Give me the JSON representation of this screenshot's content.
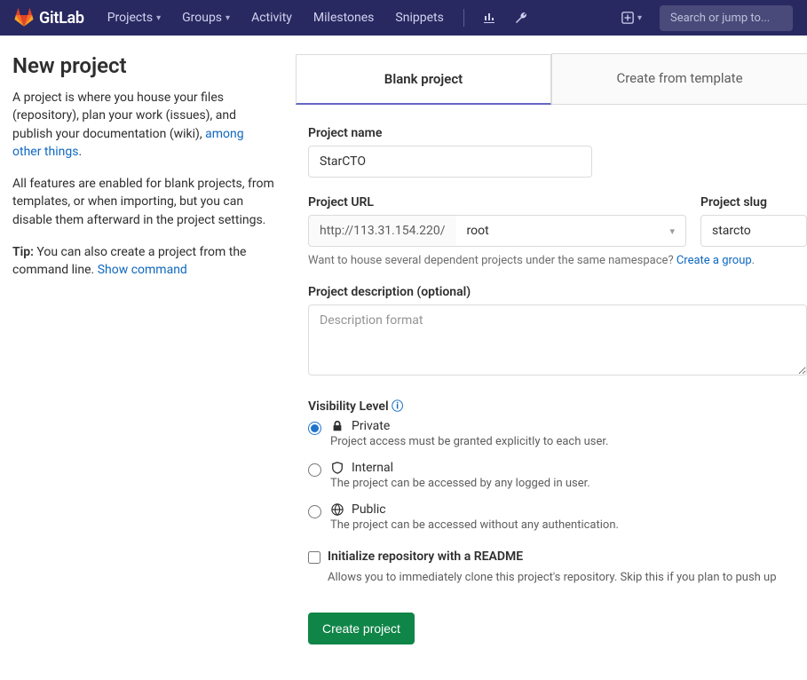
{
  "nav": {
    "brand": "GitLab",
    "items": [
      "Projects",
      "Groups",
      "Activity",
      "Milestones",
      "Snippets"
    ],
    "search_placeholder": "Search or jump to..."
  },
  "side": {
    "title": "New project",
    "p1a": "A project is where you house your files (repository), plan your work (issues), and publish your documentation (wiki), ",
    "p1_link": "among other things",
    "p2": "All features are enabled for blank projects, from templates, or when importing, but you can disable them afterward in the project settings.",
    "p3a": "Tip:",
    "p3b": " You can also create a project from the command line. ",
    "p3_link": "Show command"
  },
  "tabs": {
    "blank": "Blank project",
    "template": "Create from template"
  },
  "form": {
    "name_label": "Project name",
    "name_value": "StarCTO",
    "url_label": "Project URL",
    "url_prefix": "http://113.31.154.220/",
    "namespace": "root",
    "slug_label": "Project slug",
    "slug_value": "starcto",
    "ns_hint_a": "Want to house several dependent projects under the same namespace? ",
    "ns_hint_link": "Create a group",
    "desc_label": "Project description (optional)",
    "desc_placeholder": "Description format",
    "vis_label": "Visibility Level",
    "vis": [
      {
        "key": "private",
        "title": "Private",
        "desc": "Project access must be granted explicitly to each user.",
        "checked": true
      },
      {
        "key": "internal",
        "title": "Internal",
        "desc": "The project can be accessed by any logged in user.",
        "checked": false
      },
      {
        "key": "public",
        "title": "Public",
        "desc": "The project can be accessed without any authentication.",
        "checked": false
      }
    ],
    "readme_title": "Initialize repository with a README",
    "readme_desc": "Allows you to immediately clone this project's repository. Skip this if you plan to push up",
    "submit": "Create project"
  }
}
